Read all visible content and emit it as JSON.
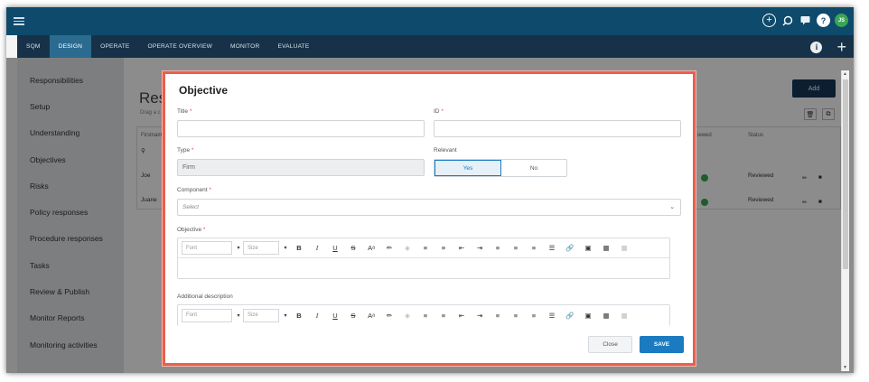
{
  "topbar": {
    "avatar_initials": "JS"
  },
  "nav": {
    "items": [
      "SQM",
      "DESIGN",
      "OPERATE",
      "OPERATE OVERVIEW",
      "MONITOR",
      "EVALUATE"
    ]
  },
  "sidebar": {
    "items": [
      "Responsibilities",
      "Setup",
      "Understanding",
      "Objectives",
      "Risks",
      "Policy responses",
      "Procedure responses",
      "Tasks",
      "Review & Publish",
      "Monitor Reports",
      "Monitoring activities"
    ]
  },
  "background": {
    "title_partial": "Resp",
    "subtitle_partial": "Drag a c",
    "add_button": "Add",
    "table": {
      "col_first": "Firstnam",
      "col_reviewed": "iewed",
      "col_status": "Status",
      "rows": [
        {
          "first": "Joe",
          "status": "Reviewed"
        },
        {
          "first": "Juane",
          "status": "Reviewed"
        }
      ]
    }
  },
  "modal": {
    "title": "Objective",
    "fields": {
      "title_label": "Title",
      "id_label": "ID",
      "type_label": "Type",
      "type_value": "Firm",
      "relevant_label": "Relevant",
      "relevant_yes": "Yes",
      "relevant_no": "No",
      "component_label": "Component",
      "component_placeholder": "Select",
      "objective_label": "Objective",
      "additional_label": "Additional description"
    },
    "editor": {
      "font_placeholder": "Font",
      "size_placeholder": "Size"
    },
    "buttons": {
      "close": "Close",
      "save": "SAVE"
    }
  },
  "colors": {
    "topbar": "#0e4a6b",
    "navbar": "#173248",
    "accent": "#1b7bc0",
    "modal_border": "#e8604c"
  }
}
